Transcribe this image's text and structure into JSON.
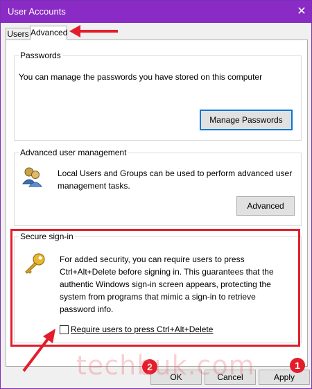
{
  "window": {
    "title": "User Accounts",
    "close_glyph": "✕"
  },
  "tabs": [
    {
      "label": "Users"
    },
    {
      "label": "Advanced"
    }
  ],
  "passwords": {
    "label": "Passwords",
    "description": "You can manage the passwords you have stored on this computer",
    "button": "Manage Passwords"
  },
  "advanced_mgmt": {
    "label": "Advanced user management",
    "description_line1": "Local Users and Groups can be used to perform advanced user",
    "description_line2": "management tasks.",
    "button": "Advanced",
    "icon": "users-group-icon"
  },
  "secure_signin": {
    "label": "Secure sign-in",
    "line1": "For added security, you can require users to press",
    "line2": "Ctrl+Alt+Delete before signing in. This guarantees that the",
    "line3": "authentic Windows sign-in screen appears, protecting the",
    "line4": "system from programs that mimic a sign-in to retrieve",
    "line5": "password info.",
    "checkbox_label": "Require users to press Ctrl+Alt+Delete",
    "checkbox_checked": false,
    "icon": "key-icon"
  },
  "footer": {
    "ok": "OK",
    "cancel": "Cancel",
    "apply": "Apply"
  },
  "annotations": {
    "badge1": "1",
    "badge2": "2",
    "highlight_color": "#e31d2b"
  },
  "watermark": "techbuk.com",
  "colors": {
    "titlebar": "#8a2bc5",
    "accent": "#0078d7",
    "annotation": "#e31d2b"
  }
}
